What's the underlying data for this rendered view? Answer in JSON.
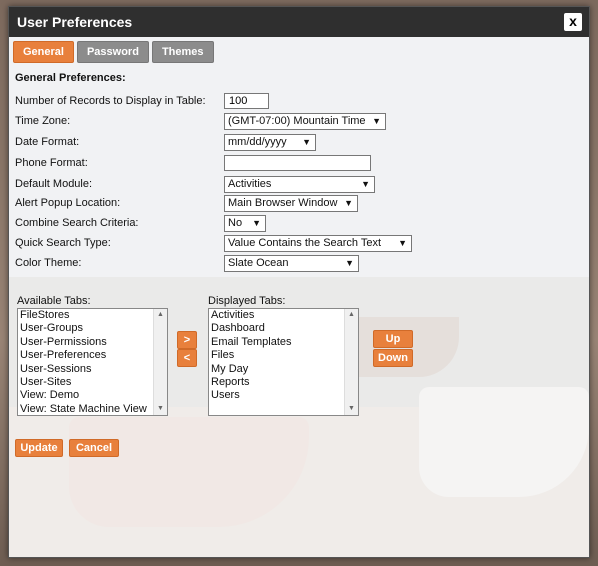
{
  "window": {
    "title": "User Preferences",
    "close_label": "x"
  },
  "tabs": [
    {
      "label": "General",
      "active": true
    },
    {
      "label": "Password",
      "active": false
    },
    {
      "label": "Themes",
      "active": false
    }
  ],
  "section_title": "General Preferences:",
  "fields": {
    "records": {
      "label": "Number of Records to Display in Table:",
      "value": "100"
    },
    "timezone": {
      "label": "Time Zone:",
      "value": "(GMT-07:00) Mountain Time"
    },
    "date_format": {
      "label": "Date Format:",
      "value": "mm/dd/yyyy"
    },
    "phone_format": {
      "label": "Phone Format:",
      "value": ""
    },
    "default_module": {
      "label": "Default Module:",
      "value": "Activities"
    },
    "alert_popup": {
      "label": "Alert Popup Location:",
      "value": "Main Browser Window"
    },
    "combine_search": {
      "label": "Combine Search Criteria:",
      "value": "No"
    },
    "quick_search": {
      "label": "Quick Search Type:",
      "value": "Value Contains the Search Text"
    },
    "color_theme": {
      "label": "Color Theme:",
      "value": "Slate Ocean"
    }
  },
  "available_tabs": {
    "label": "Available Tabs:",
    "items": [
      "FileStores",
      "User-Groups",
      "User-Permissions",
      "User-Preferences",
      "User-Sessions",
      "User-Sites",
      "View: Demo",
      "View: State Machine View"
    ]
  },
  "displayed_tabs": {
    "label": "Displayed Tabs:",
    "items": [
      "Activities",
      "Dashboard",
      "Email Templates",
      "Files",
      "My Day",
      "Reports",
      "Users"
    ]
  },
  "buttons": {
    "move_right": ">",
    "move_left": "<",
    "up": "Up",
    "down": "Down",
    "update": "Update",
    "cancel": "Cancel"
  },
  "icons": {
    "dropdown": "chevron-down-icon",
    "close": "close-icon"
  }
}
